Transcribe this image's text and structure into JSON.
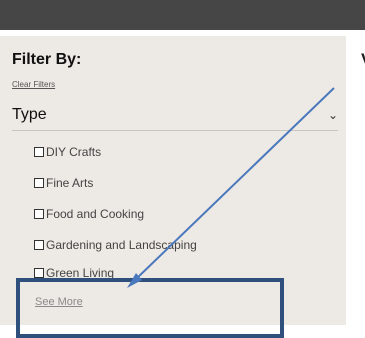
{
  "main": {
    "heading": "V"
  },
  "filter": {
    "title": "Filter By:",
    "clear_label": "Clear Filters",
    "type_label": "Type",
    "type_options": [
      {
        "label": "DIY Crafts",
        "checked": false
      },
      {
        "label": "Fine Arts",
        "checked": false
      },
      {
        "label": "Food and Cooking",
        "checked": false
      },
      {
        "label": "Gardening and Landscaping",
        "checked": false
      },
      {
        "label": "Green Living",
        "checked": false
      }
    ],
    "see_more_label": "See More"
  },
  "icons": {
    "chevron": "chevron-down-icon",
    "checkbox": "checkbox-icon"
  },
  "colors": {
    "top_bar": "#464646",
    "panel_background": "#ede9e4",
    "annotation_arrow": "#4a78bd",
    "highlight_box": "#2f4f7d"
  }
}
